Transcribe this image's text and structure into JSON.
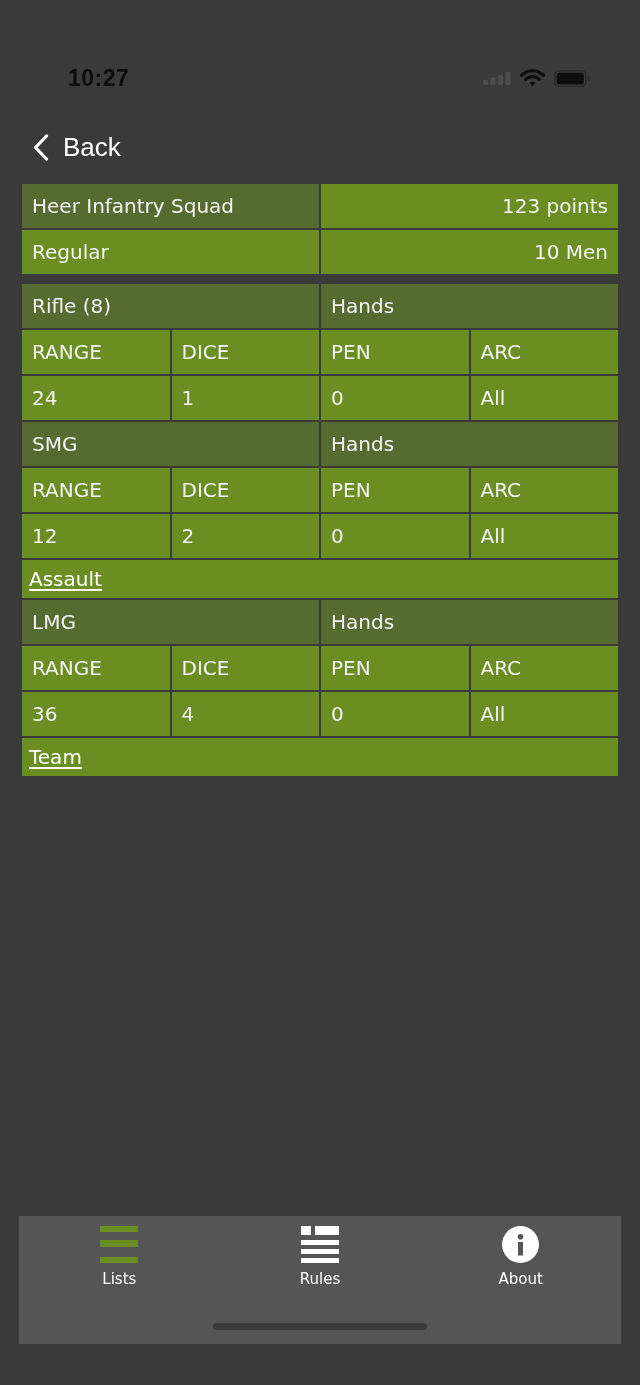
{
  "status_bar": {
    "time": "10:27"
  },
  "nav": {
    "back": "Back"
  },
  "unit": {
    "name": "Heer Infantry Squad",
    "points": "123 points",
    "quality": "Regular",
    "size": "10 Men"
  },
  "weapons": [
    {
      "name": "Rifle (8)",
      "type": "Hands",
      "columns": [
        "RANGE",
        "DICE",
        "PEN",
        "ARC"
      ],
      "values": [
        "24",
        "1",
        "0",
        "All"
      ]
    },
    {
      "name": "SMG",
      "type": "Hands",
      "columns": [
        "RANGE",
        "DICE",
        "PEN",
        "ARC"
      ],
      "values": [
        "12",
        "2",
        "0",
        "All"
      ],
      "rules": [
        "Assault"
      ]
    },
    {
      "name": "LMG",
      "type": "Hands",
      "columns": [
        "RANGE",
        "DICE",
        "PEN",
        "ARC"
      ],
      "values": [
        "36",
        "4",
        "0",
        "All"
      ],
      "rules": [
        "Team"
      ]
    }
  ],
  "tab_bar": {
    "tabs": [
      {
        "label": "Lists",
        "selected": true
      },
      {
        "label": "Rules",
        "selected": false
      },
      {
        "label": "About",
        "selected": false
      }
    ]
  }
}
